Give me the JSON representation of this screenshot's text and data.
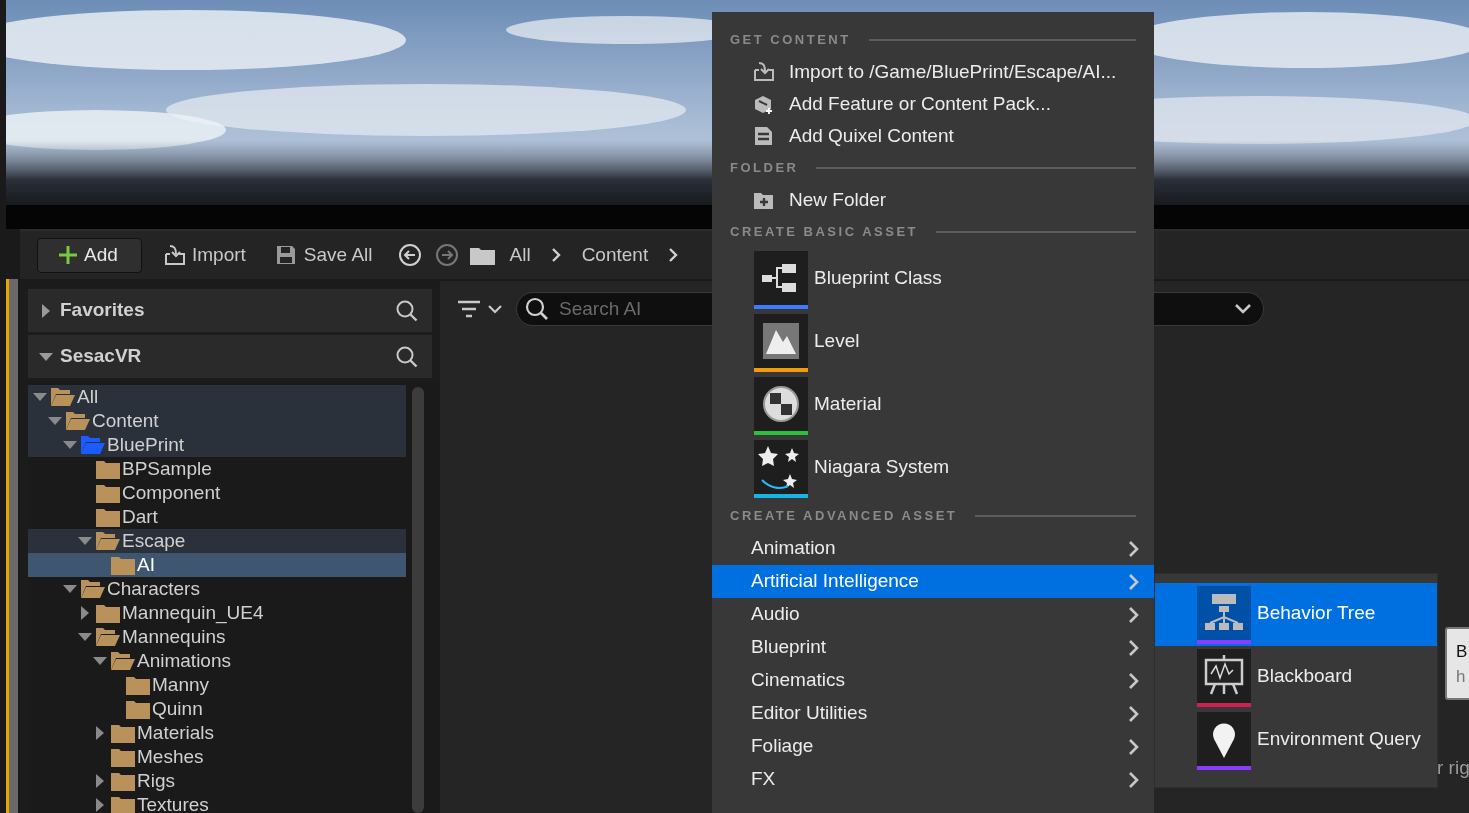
{
  "toolbar": {
    "add_button": "Add",
    "import_button": "Import",
    "save_button": "Save All",
    "breadcrumbs": [
      "All",
      "Content"
    ]
  },
  "sidebar": {
    "sections": [
      {
        "title": "Favorites",
        "expanded": false
      },
      {
        "title": "SesacVR",
        "expanded": true
      }
    ],
    "tree": [
      {
        "label": "All",
        "expanded": true,
        "selected": false,
        "highlighted": true,
        "color": "#b8925a",
        "children": [
          {
            "label": "Content",
            "expanded": true,
            "selected": false,
            "highlighted": true,
            "color": "#b8925a",
            "children": [
              {
                "label": "BluePrint",
                "expanded": true,
                "selected": false,
                "highlighted": true,
                "color": "#1a5cff",
                "children": [
                  {
                    "label": "BPSample",
                    "selected": false,
                    "highlighted": false,
                    "color": "#b8925a"
                  },
                  {
                    "label": "Component",
                    "selected": false,
                    "highlighted": false,
                    "color": "#b8925a"
                  },
                  {
                    "label": "Dart",
                    "selected": false,
                    "highlighted": false,
                    "color": "#b8925a"
                  },
                  {
                    "label": "Escape",
                    "expanded": true,
                    "selected": false,
                    "highlighted": true,
                    "color": "#b8925a",
                    "children": [
                      {
                        "label": "AI",
                        "selected": true,
                        "highlighted": false,
                        "color": "#b8925a"
                      }
                    ]
                  }
                ]
              },
              {
                "label": "Characters",
                "expanded": true,
                "selected": false,
                "highlighted": false,
                "color": "#b8925a",
                "children": [
                  {
                    "label": "Mannequin_UE4",
                    "expanded": false,
                    "selected": false,
                    "highlighted": false,
                    "color": "#b8925a"
                  },
                  {
                    "label": "Mannequins",
                    "expanded": true,
                    "selected": false,
                    "highlighted": false,
                    "color": "#b8925a",
                    "children": [
                      {
                        "label": "Animations",
                        "expanded": true,
                        "selected": false,
                        "highlighted": false,
                        "color": "#b8925a",
                        "children": [
                          {
                            "label": "Manny",
                            "selected": false,
                            "highlighted": false,
                            "color": "#b8925a"
                          },
                          {
                            "label": "Quinn",
                            "selected": false,
                            "highlighted": false,
                            "color": "#b8925a"
                          }
                        ]
                      },
                      {
                        "label": "Materials",
                        "expanded": false,
                        "selected": false,
                        "highlighted": false,
                        "color": "#b8925a"
                      },
                      {
                        "label": "Meshes",
                        "selected": false,
                        "highlighted": false,
                        "color": "#b8925a"
                      },
                      {
                        "label": "Rigs",
                        "expanded": false,
                        "selected": false,
                        "highlighted": false,
                        "color": "#b8925a"
                      },
                      {
                        "label": "Textures",
                        "expanded": false,
                        "selected": false,
                        "highlighted": false,
                        "color": "#b8925a"
                      }
                    ]
                  }
                ]
              }
            ]
          }
        ]
      }
    ]
  },
  "content": {
    "search": {
      "placeholder": "Search AI"
    },
    "hint_fragment": "r rig"
  },
  "add_menu": {
    "sections": [
      {
        "heading": "GET CONTENT",
        "kind": "commands",
        "items": [
          {
            "label": "Import to /Game/BluePrint/Escape/AI..."
          },
          {
            "label": "Add Feature or Content Pack..."
          },
          {
            "label": "Add Quixel Content"
          }
        ]
      },
      {
        "heading": "FOLDER",
        "kind": "commands",
        "items": [
          {
            "label": "New Folder"
          }
        ]
      },
      {
        "heading": "CREATE BASIC ASSET",
        "kind": "assets",
        "items": [
          {
            "label": "Blueprint Class",
            "color": "#3a7bff"
          },
          {
            "label": "Level",
            "color": "#f29b0c"
          },
          {
            "label": "Material",
            "color": "#2fbf3f"
          },
          {
            "label": "Niagara System",
            "color": "#18b4e6"
          }
        ]
      },
      {
        "heading": "CREATE ADVANCED ASSET",
        "kind": "submenus",
        "items": [
          {
            "label": "Animation",
            "selected": false
          },
          {
            "label": "Artificial Intelligence",
            "selected": true
          },
          {
            "label": "Audio",
            "selected": false
          },
          {
            "label": "Blueprint",
            "selected": false
          },
          {
            "label": "Cinematics",
            "selected": false
          },
          {
            "label": "Editor Utilities",
            "selected": false
          },
          {
            "label": "Foliage",
            "selected": false
          },
          {
            "label": "FX",
            "selected": false
          }
        ]
      }
    ]
  },
  "submenu": {
    "items": [
      {
        "label": "Behavior Tree",
        "selected": true,
        "color": "#8a3cff"
      },
      {
        "label": "Blackboard",
        "selected": false,
        "color": "#d0204f"
      },
      {
        "label": "Environment Query",
        "selected": false,
        "color": "#8a3cff"
      }
    ]
  },
  "tooltip": {
    "title": "B",
    "body": "h"
  }
}
